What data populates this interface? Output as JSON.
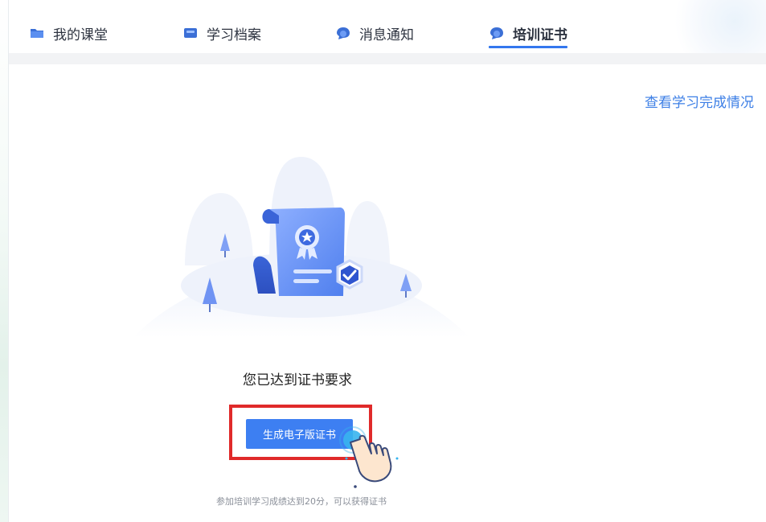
{
  "tabs": [
    {
      "label": "我的课堂",
      "icon": "folder-icon",
      "active": false
    },
    {
      "label": "学习档案",
      "icon": "archive-icon",
      "active": false
    },
    {
      "label": "消息通知",
      "icon": "message-icon",
      "active": false
    },
    {
      "label": "培训证书",
      "icon": "certificate-icon",
      "active": true
    }
  ],
  "main": {
    "view_progress_link": "查看学习完成情况",
    "status_text": "您已达到证书要求",
    "generate_button": "生成电子版证书",
    "hint_text": "参加培训学习成绩达到20分，可以获得证书"
  },
  "colors": {
    "accent": "#3d7ff2",
    "link": "#3d7fe6",
    "highlight_border": "#e02a2a",
    "tab_underline": "#3377ee"
  }
}
